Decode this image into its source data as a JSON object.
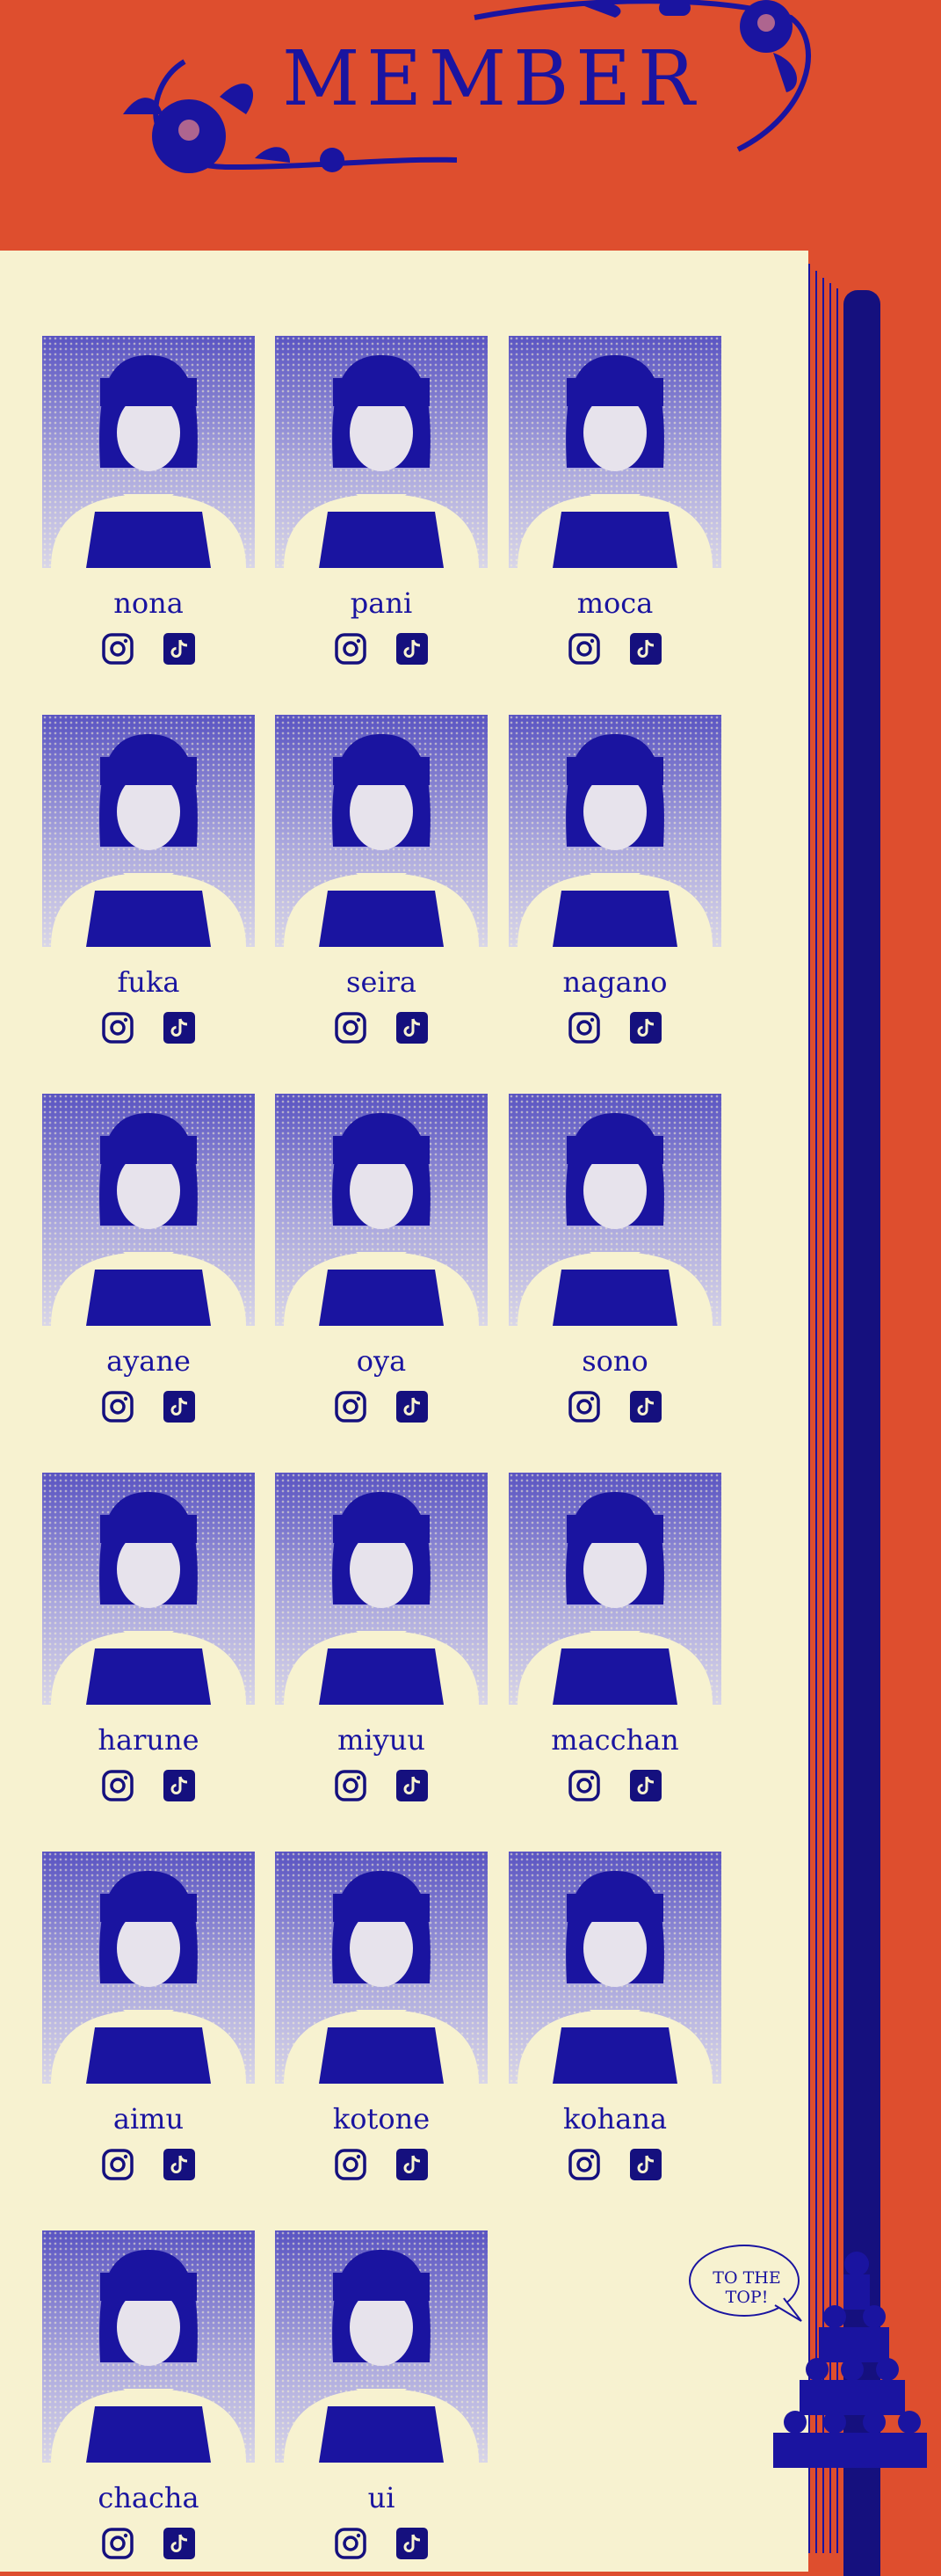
{
  "header": {
    "title": "MEMBER"
  },
  "members": [
    {
      "name": "nona"
    },
    {
      "name": "pani"
    },
    {
      "name": "moca"
    },
    {
      "name": "fuka"
    },
    {
      "name": "seira"
    },
    {
      "name": "nagano"
    },
    {
      "name": "ayane"
    },
    {
      "name": "oya"
    },
    {
      "name": "sono"
    },
    {
      "name": "harune"
    },
    {
      "name": "miyuu"
    },
    {
      "name": "macchan"
    },
    {
      "name": "aimu"
    },
    {
      "name": "kotone"
    },
    {
      "name": "kohana"
    },
    {
      "name": "chacha"
    },
    {
      "name": "ui"
    }
  ],
  "icons": {
    "instagram": "instagram-icon",
    "tiktok": "tiktok-icon"
  },
  "to_top": {
    "label_line1": "TO THE",
    "label_line2": "TOP!"
  },
  "colors": {
    "background": "#DE4E2E",
    "paper": "#F7F2D0",
    "ink": "#1A14A0",
    "spine": "#15107E"
  }
}
